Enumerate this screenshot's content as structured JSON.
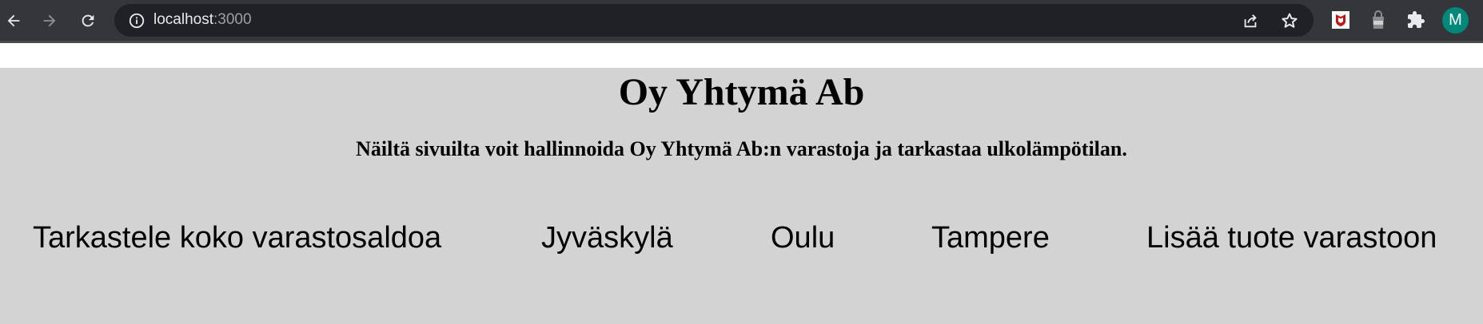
{
  "browser": {
    "address": {
      "host": "localhost",
      "port": ":3000"
    },
    "profile_initial": "M",
    "icons": [
      "back-icon",
      "forward-icon",
      "reload-icon",
      "info-icon",
      "share-icon",
      "star-icon",
      "mcafee-icon",
      "avg-icon",
      "extensions-icon"
    ]
  },
  "page": {
    "title": "Oy Yhtymä Ab",
    "subtitle": "Näiltä sivuilta voit hallinnoida Oy Yhtymä Ab:n varastoja ja tarkastaa ulkolämpötilan.",
    "nav": [
      {
        "label": "Tarkastele koko varastosaldoa"
      },
      {
        "label": "Jyväskylä"
      },
      {
        "label": "Oulu"
      },
      {
        "label": "Tampere"
      },
      {
        "label": "Lisää tuote varastoon"
      }
    ],
    "background_color": "#d3d3d3"
  }
}
